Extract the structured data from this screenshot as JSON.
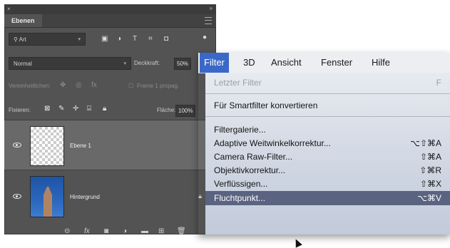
{
  "layers_panel": {
    "tab_label": "Ebenen",
    "filter_kind": "Art",
    "blend_mode": "Normal",
    "opacity_label": "Deckkraft:",
    "opacity_value": "50%",
    "unify_label": "Vereinheitlichen:",
    "propagate_label": "Frame 1 propag.",
    "lock_label": "Fixieren:",
    "fill_label": "Fläche:",
    "fill_value": "100%",
    "layers": [
      {
        "name": "Ebene 1",
        "selected": true
      },
      {
        "name": "Hintergrund",
        "selected": false
      }
    ]
  },
  "menubar": {
    "items": [
      "Filter",
      "3D",
      "Ansicht",
      "Fenster",
      "Hilfe"
    ]
  },
  "filter_menu": {
    "items": [
      {
        "label": "Letzter Filter",
        "shortcut": "F",
        "disabled": true
      },
      {
        "label": "Für Smartfilter konvertieren",
        "shortcut": ""
      },
      {
        "label": "Filtergalerie...",
        "shortcut": ""
      },
      {
        "label": "Adaptive Weitwinkelkorrektur...",
        "shortcut": "⌥⇧⌘A"
      },
      {
        "label": "Camera Raw-Filter...",
        "shortcut": "⇧⌘A"
      },
      {
        "label": "Objektivkorrektur...",
        "shortcut": "⇧⌘R"
      },
      {
        "label": "Verflüssigen...",
        "shortcut": "⇧⌘X"
      },
      {
        "label": "Fluchtpunkt...",
        "shortcut": "⌥⌘V",
        "highlighted": true
      }
    ]
  },
  "colors": {
    "panel_bg": "#535353",
    "menubar_active": "#3b68c8",
    "menu_highlight": "#5a6380"
  }
}
